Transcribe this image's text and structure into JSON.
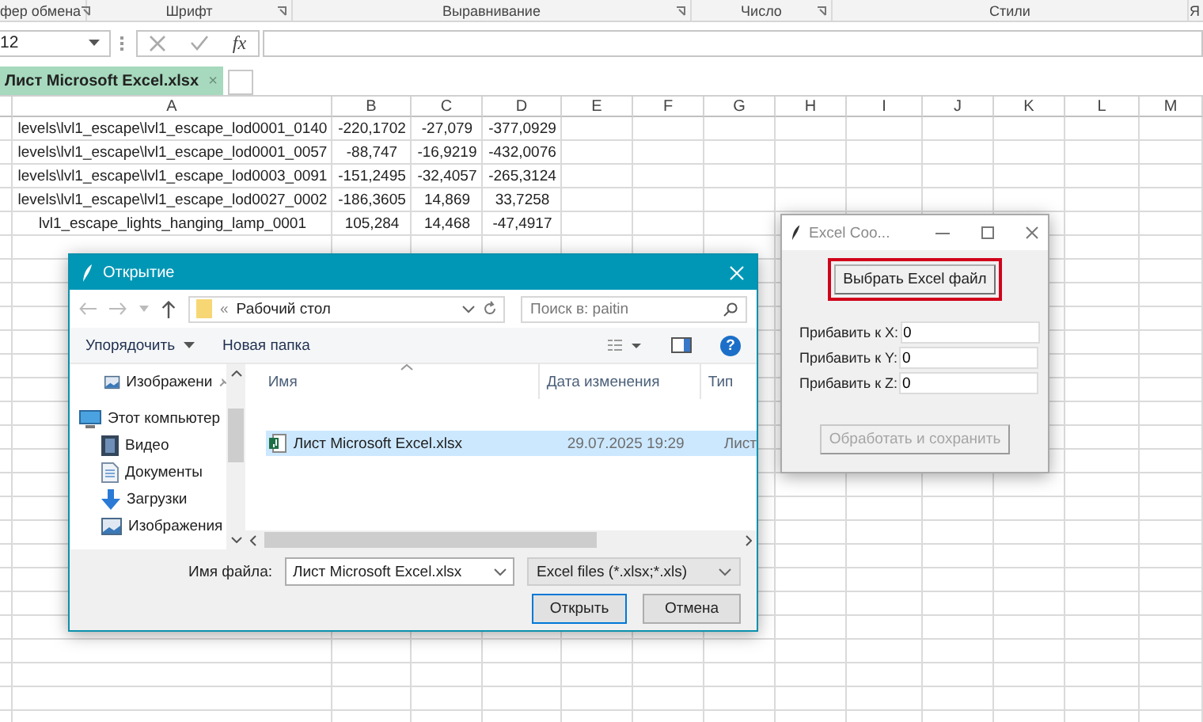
{
  "ribbon_groups": [
    {
      "label": "фер обмена",
      "launcher": true
    },
    {
      "label": "Шрифт",
      "launcher": true
    },
    {
      "label": "Выравнивание",
      "launcher": true
    },
    {
      "label": "Число",
      "launcher": true
    },
    {
      "label": "Стили",
      "launcher": false
    },
    {
      "label": "Я",
      "launcher": false
    }
  ],
  "name_box": "12",
  "function_label": "fx",
  "workbook_tab": {
    "title": "Лист Microsoft Excel.xlsx",
    "close": "×"
  },
  "sheet": {
    "columns": [
      "A",
      "B",
      "C",
      "D",
      "E",
      "F",
      "G",
      "H",
      "I",
      "J",
      "K",
      "L",
      "M"
    ],
    "rows": [
      [
        "levels\\lvl1_escape\\lvl1_escape_lod0001_0140",
        "-220,1702",
        "-27,079",
        "-377,0929"
      ],
      [
        "levels\\lvl1_escape\\lvl1_escape_lod0001_0057",
        "-88,747",
        "-16,9219",
        "-432,0076"
      ],
      [
        "levels\\lvl1_escape\\lvl1_escape_lod0003_0091",
        "-151,2495",
        "-32,4057",
        "-265,3124"
      ],
      [
        "levels\\lvl1_escape\\lvl1_escape_lod0027_0002",
        "-186,3605",
        "14,869",
        "33,7258"
      ],
      [
        "lvl1_escape_lights_hanging_lamp_0001",
        "105,284",
        "14,468",
        "-47,4917"
      ]
    ]
  },
  "open_dialog": {
    "title": "Открытие",
    "path_prefix": "«",
    "path": "Рабочий стол",
    "search_placeholder": "Поиск в: paitin",
    "organize": "Упорядочить",
    "new_folder": "Новая папка",
    "help": "?",
    "nav_items": [
      {
        "label": "Изображени",
        "kind": "pictures",
        "pinned": true
      },
      {
        "label": "Этот компьютер",
        "kind": "computer",
        "pinned": false,
        "children": [
          {
            "label": "Видео",
            "kind": "video",
            "pinned": false
          },
          {
            "label": "Документы",
            "kind": "documents",
            "pinned": false
          },
          {
            "label": "Загрузки",
            "kind": "downloads",
            "pinned": false
          },
          {
            "label": "Изображения",
            "kind": "pictures",
            "pinned": false
          }
        ]
      }
    ],
    "columns": [
      "Имя",
      "Дата изменения",
      "Тип"
    ],
    "files": [
      {
        "name": "Лист Microsoft Excel.xlsx",
        "date": "29.07.2025 19:29",
        "type": "Лист",
        "selected": true
      }
    ],
    "filename_label": "Имя файла:",
    "filename": "Лист Microsoft Excel.xlsx",
    "file_type": "Excel files (*.xlsx;*.xls)",
    "open_button": "Открыть",
    "cancel_button": "Отмена"
  },
  "app_window": {
    "title": "Excel Coo...",
    "select_button": {
      "label": "Выбрать Excel файл",
      "highlighted": true
    },
    "fields": [
      {
        "label": "Прибавить к X:",
        "value": "0"
      },
      {
        "label": "Прибавить к Y:",
        "value": "0"
      },
      {
        "label": "Прибавить к Z:",
        "value": "0"
      }
    ],
    "process_button": {
      "label": "Обработать и сохранить",
      "disabled": true
    }
  }
}
